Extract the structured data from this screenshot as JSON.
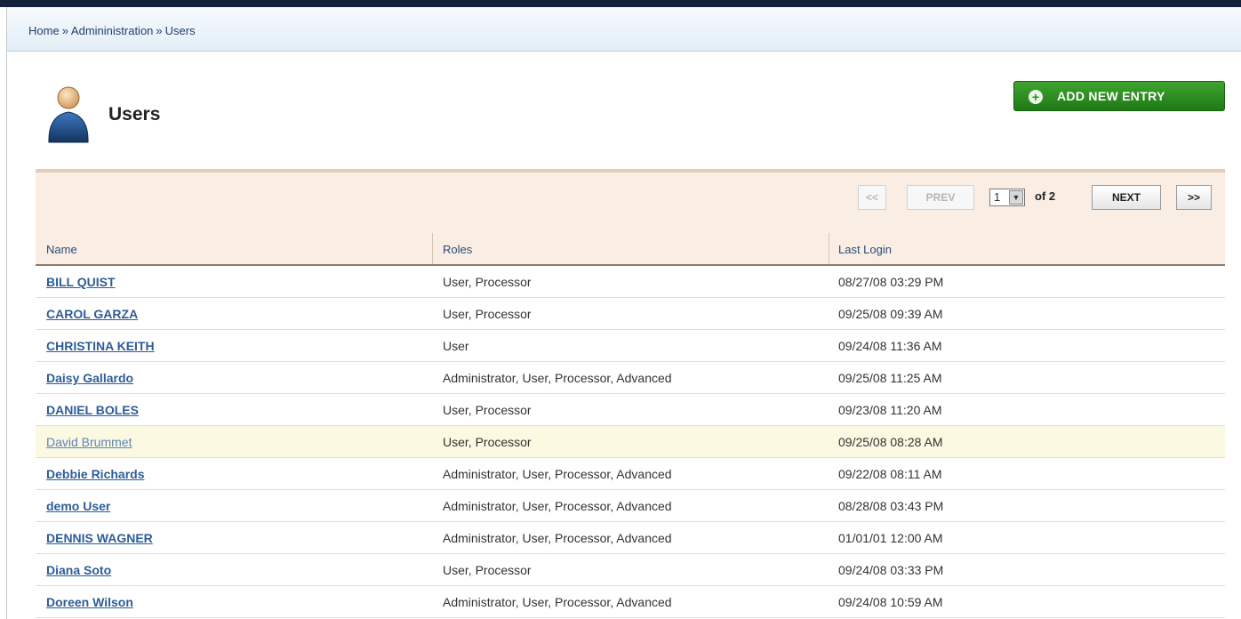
{
  "breadcrumb": [
    "Home",
    "Admininistration",
    "Users"
  ],
  "breadcrumb_separator": "»",
  "page": {
    "title": "Users",
    "icon": "user-icon"
  },
  "add_button": {
    "label": "ADD NEW ENTRY",
    "icon": "plus-circle-icon",
    "color": "#2a8f1f"
  },
  "pagination": {
    "first_label": "<<",
    "prev_label": "PREV",
    "current_page": "1",
    "of_text": "of 2",
    "next_label": "NEXT",
    "last_label": ">>"
  },
  "table": {
    "columns": [
      "Name",
      "Roles",
      "Last Login"
    ],
    "rows": [
      {
        "name": "BILL QUIST",
        "roles": "User, Processor",
        "last_login": "08/27/08 03:29 PM"
      },
      {
        "name": "CAROL GARZA",
        "roles": "User, Processor",
        "last_login": "09/25/08 09:39 AM"
      },
      {
        "name": "CHRISTINA KEITH",
        "roles": "User",
        "last_login": "09/24/08 11:36 AM"
      },
      {
        "name": "Daisy Gallardo",
        "roles": "Administrator, User, Processor, Advanced",
        "last_login": "09/25/08 11:25 AM"
      },
      {
        "name": "DANIEL BOLES",
        "roles": "User, Processor",
        "last_login": "09/23/08 11:20 AM"
      },
      {
        "name": "David Brummet",
        "roles": "User, Processor",
        "last_login": "09/25/08 08:28 AM"
      },
      {
        "name": "Debbie Richards",
        "roles": "Administrator, User, Processor, Advanced",
        "last_login": "09/22/08 08:11 AM"
      },
      {
        "name": "demo User",
        "roles": "Administrator, User, Processor, Advanced",
        "last_login": "08/28/08 03:43 PM"
      },
      {
        "name": "DENNIS WAGNER",
        "roles": "Administrator, User, Processor, Advanced",
        "last_login": "01/01/01 12:00 AM"
      },
      {
        "name": "Diana Soto",
        "roles": "User, Processor",
        "last_login": "09/24/08 03:33 PM"
      },
      {
        "name": "Doreen Wilson",
        "roles": "Administrator, User, Processor, Advanced",
        "last_login": "09/24/08 10:59 AM"
      }
    ]
  },
  "colors": {
    "link": "#2d5c98",
    "header_bg": "#faeee4",
    "highlight_row": "#fbf9e2"
  }
}
